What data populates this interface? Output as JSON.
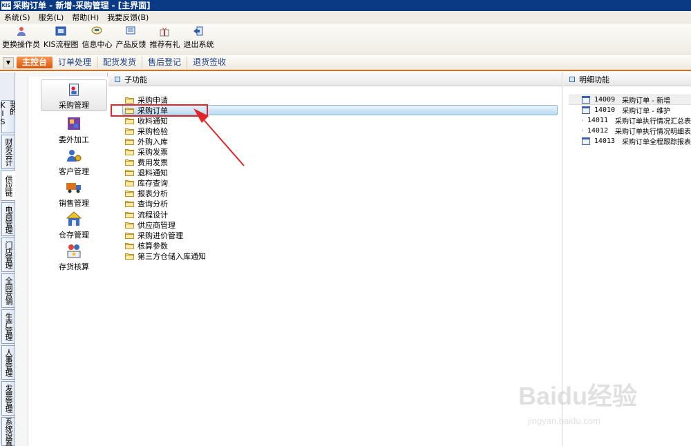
{
  "window": {
    "title": "采购订单 - 新增-采购管理 - [主界面]",
    "logo_text": "KIS"
  },
  "menubar": [
    {
      "label": "系统(S)"
    },
    {
      "label": "服务(L)"
    },
    {
      "label": "帮助(H)"
    },
    {
      "label": "我要反馈(B)"
    }
  ],
  "toolbar": [
    {
      "label": "更换操作员",
      "icon": "change-operator-icon"
    },
    {
      "label": "KIS流程图",
      "icon": "flowchart-icon"
    },
    {
      "label": "信息中心",
      "icon": "info-center-icon"
    },
    {
      "label": "产品反馈",
      "icon": "feedback-icon"
    },
    {
      "label": "推荐有礼",
      "icon": "gift-icon"
    },
    {
      "label": "退出系统",
      "icon": "exit-icon"
    }
  ],
  "tabs": {
    "active": "主控台",
    "items": [
      "订单处理",
      "配货发货",
      "售后登记",
      "退货签收"
    ]
  },
  "vtabs": [
    {
      "label": "我的KIS"
    },
    {
      "label": "财务会计"
    },
    {
      "label": "供应链"
    },
    {
      "label": "电商管理"
    },
    {
      "label": "门店管理"
    },
    {
      "label": "全网营销"
    },
    {
      "label": "生产管理"
    },
    {
      "label": "人事管理"
    },
    {
      "label": "发票管理"
    },
    {
      "label": "系统设置"
    }
  ],
  "modules": [
    {
      "label": "采购管理",
      "icon": "purchase-icon"
    },
    {
      "label": "委外加工",
      "icon": "outsource-icon"
    },
    {
      "label": "客户管理",
      "icon": "customer-icon"
    },
    {
      "label": "销售管理",
      "icon": "sales-truck-icon"
    },
    {
      "label": "仓存管理",
      "icon": "warehouse-icon"
    },
    {
      "label": "存货核算",
      "icon": "inventory-icon"
    }
  ],
  "sub_panel": {
    "header": "子功能",
    "items": [
      "采购申请",
      "采购订单",
      "收料通知",
      "采购检验",
      "外购入库",
      "采购发票",
      "费用发票",
      "退料通知",
      "库存查询",
      "报表分析",
      "查询分析",
      "流程设计",
      "供应商管理",
      "采购进价管理",
      "核算参数",
      "第三方仓储入库通知"
    ],
    "selected_index": 1
  },
  "detail_panel": {
    "header": "明细功能",
    "items": [
      {
        "code": "14009",
        "label": "采购订单 - 新增"
      },
      {
        "code": "14010",
        "label": "采购订单 - 维护"
      },
      {
        "code": "14011",
        "label": "采购订单执行情况汇总表"
      },
      {
        "code": "14012",
        "label": "采购订单执行情况明细表"
      },
      {
        "code": "14013",
        "label": "采购订单全程跟踪报表"
      }
    ]
  },
  "watermark": {
    "main": "Baidu经验",
    "sub": "jingyan.baidu.com"
  },
  "colors": {
    "titlebar": "#0b3a84",
    "accent_tab": "#e36a1c",
    "highlight": "#e0242a",
    "link": "#1a3e86"
  }
}
